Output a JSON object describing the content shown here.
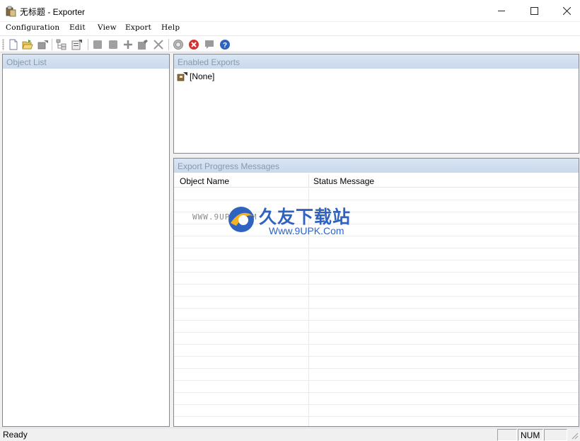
{
  "window": {
    "title": "无标题 - Exporter",
    "controls": {
      "minimize": "─",
      "maximize": "☐",
      "close": "✕"
    }
  },
  "menu": [
    "Configuration",
    "Edit",
    "View",
    "Export",
    "Help"
  ],
  "toolbar": {
    "buttons": [
      {
        "name": "new-icon"
      },
      {
        "name": "open-folder-icon"
      },
      {
        "name": "export-disabled-icon"
      },
      {
        "name": "tree-view-icon"
      },
      {
        "name": "properties-icon"
      },
      {
        "name": "stop-icon"
      },
      {
        "name": "stop-alt-icon"
      },
      {
        "name": "add-icon"
      },
      {
        "name": "edit-icon"
      },
      {
        "name": "delete-icon"
      },
      {
        "name": "target-icon"
      },
      {
        "name": "cancel-icon"
      },
      {
        "name": "comment-icon"
      },
      {
        "name": "help-icon"
      }
    ]
  },
  "panes": {
    "object_list": {
      "title": "Object List"
    },
    "enabled_exports": {
      "title": "Enabled Exports",
      "items": [
        "[None]"
      ]
    },
    "progress": {
      "title": "Export Progress Messages",
      "columns": [
        "Object Name",
        "Status Message"
      ]
    }
  },
  "watermark": {
    "small": "WWW.9UPK.COM",
    "big": "久友下载站",
    "url": "Www.9UPK.Com"
  },
  "status": {
    "text": "Ready",
    "indicators": [
      "",
      "NUM",
      ""
    ]
  },
  "colors": {
    "header_bg": "#c9d9ec",
    "header_text": "#8a9aad",
    "watermark_blue": "#2f63bf"
  }
}
